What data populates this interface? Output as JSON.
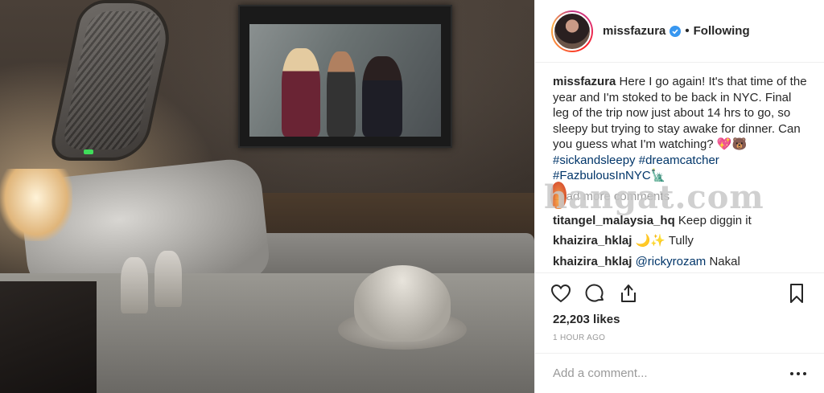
{
  "post": {
    "username": "missfazura",
    "follow_state": "Following",
    "separator": "•"
  },
  "caption": {
    "username": "missfazura",
    "text": "Here I go again! It's that time of the year and I'm stoked to be back in NYC. Final leg of the trip now just about 14 hrs to go, so sleepy but trying to stay awake for dinner. Can you guess what I'm watching? 💖🐻 ",
    "hashtags": [
      "#sickandsleepy",
      "#dreamcatcher",
      "#FazbulousInNYC🗽"
    ]
  },
  "load_more": "Load more comments",
  "comments": [
    {
      "user": "titangel_malaysia_hq",
      "text": "Keep diggin it",
      "mention": ""
    },
    {
      "user": "khaizira_hklaj",
      "text": "🌙✨ Tully",
      "mention": ""
    },
    {
      "user": "khaizira_hklaj",
      "text": "Nakal",
      "mention": "@rickyrozam"
    }
  ],
  "likes": "22,203 likes",
  "timestamp": "1 HOUR AGO",
  "add_comment_placeholder": "Add a comment...",
  "watermark": "hangat.com",
  "icons": {
    "like": "heart-icon",
    "comment": "comment-bubble-icon",
    "share": "share-icon",
    "save": "bookmark-icon",
    "verified": "verified-badge-icon",
    "more": "more-options-icon"
  },
  "colors": {
    "accent_link": "#003569",
    "verified": "#3897f0",
    "muted": "#999999"
  }
}
